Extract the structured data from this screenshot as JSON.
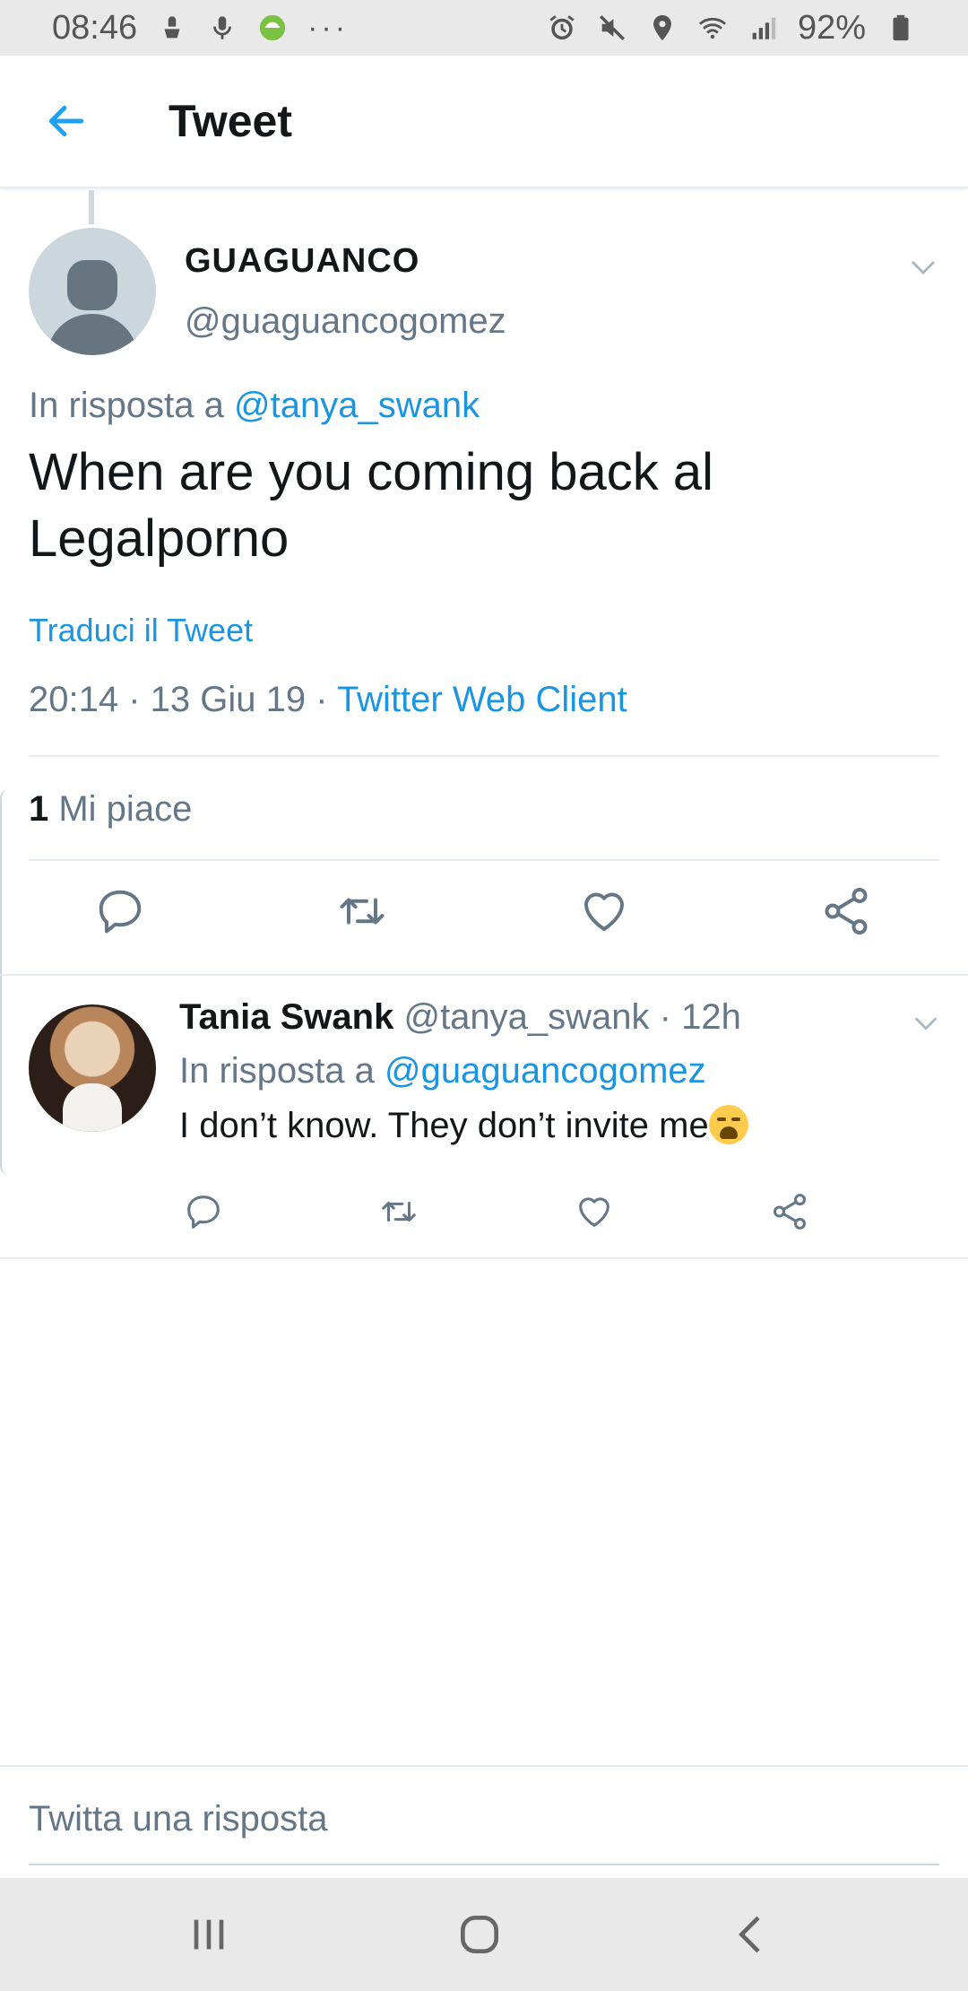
{
  "status_bar": {
    "time": "08:46",
    "battery": "92%",
    "more": "···"
  },
  "header": {
    "title": "Tweet"
  },
  "tweet": {
    "author_name": "GUAGUANCO",
    "author_handle": "@guaguancogomez",
    "reply_prefix": "In risposta a ",
    "reply_to": "@tanya_swank",
    "text": "When are you coming back al Legalporno",
    "translate": "Traduci il Tweet",
    "timestamp": "20:14 · 13 Giu 19 · ",
    "client": "Twitter Web Client",
    "likes_count": "1",
    "likes_label": " Mi piace"
  },
  "reply": {
    "author_name": "Tania Swank",
    "meta": " @tanya_swank · 12h",
    "reply_prefix": "In risposta a ",
    "reply_to": "@guaguancogomez",
    "text": "I don’t know. They don’t invite me"
  },
  "compose": {
    "placeholder": "Twitta una risposta"
  },
  "colors": {
    "accent": "#1b95e0",
    "secondary_text": "#657786",
    "divider": "#e6ecf0"
  },
  "icons": {
    "back": "arrow-left-icon",
    "more": "chevron-down-icon",
    "reply": "comment-icon",
    "retweet": "retweet-icon",
    "like": "heart-icon",
    "share": "share-icon"
  }
}
